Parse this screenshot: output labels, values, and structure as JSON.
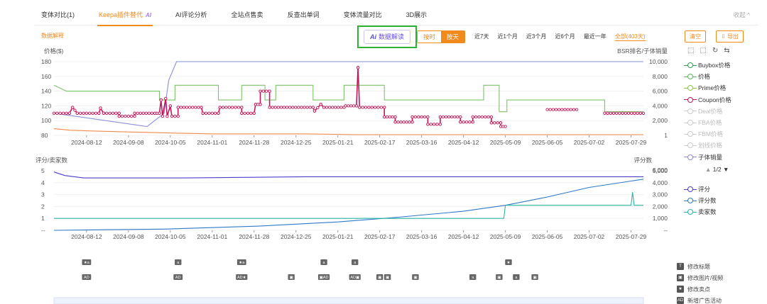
{
  "tabs": [
    {
      "label": "变体对比(1)"
    },
    {
      "label": "Keepa插件替代",
      "badge": "AI"
    },
    {
      "label": "AI评论分析"
    },
    {
      "label": "全站点售卖"
    },
    {
      "label": "反查出单词"
    },
    {
      "label": "变体流量对比"
    },
    {
      "label": "3D展示"
    }
  ],
  "collapse_label": "收起 ^",
  "toolbar": {
    "data_explain": "数据解释",
    "ai_button_icon": "Ai",
    "ai_button_label": "数据解读",
    "mode_hourly": "按时",
    "mode_daily": "按天",
    "ranges": [
      "近7天",
      "近1个月",
      "近3个月",
      "近6个月",
      "最近一年",
      "全部(403天)"
    ],
    "clear_label": "清空",
    "export_label": "导出"
  },
  "chart_icons": [
    "⬚",
    "⬚",
    "↻",
    "⇆"
  ],
  "legend_top": [
    {
      "label": "Buybox价格",
      "color": "#2e9e4f",
      "off": false
    },
    {
      "label": "价格",
      "color": "#5cb85c",
      "off": false
    },
    {
      "label": "Prime价格",
      "color": "#8bc34a",
      "off": false
    },
    {
      "label": "Coupon价格",
      "color": "#c2185b",
      "off": false
    },
    {
      "label": "Deal价格",
      "color": "#cccccc",
      "off": true
    },
    {
      "label": "FBA价格",
      "color": "#cccccc",
      "off": true
    },
    {
      "label": "FBM价格",
      "color": "#cccccc",
      "off": true
    },
    {
      "label": "划线价格",
      "color": "#cccccc",
      "off": true
    },
    {
      "label": "子体销量",
      "color": "#8a8fd8",
      "off": false
    }
  ],
  "legend_pager": "1/2",
  "legend_bottom": [
    {
      "label": "评分",
      "color": "#4b3fc7"
    },
    {
      "label": "评分数",
      "color": "#2f79c9"
    },
    {
      "label": "卖家数",
      "color": "#2bb3a8"
    }
  ],
  "event_legend": [
    {
      "icon": "T",
      "label": "修改标题"
    },
    {
      "icon": "▣",
      "label": "修改图片/视频"
    },
    {
      "icon": "★",
      "label": "修改卖点"
    },
    {
      "icon": "AD",
      "label": "新增广告活动"
    }
  ],
  "chart_data": [
    {
      "type": "line",
      "ylabel": "价格($)",
      "y2label": "BSR排名/子体销量",
      "ylim": [
        80,
        180
      ],
      "yticks": [
        80,
        100,
        120,
        140,
        160,
        180
      ],
      "y2ticks": [
        "1",
        "2,000",
        "4,000",
        "6,000",
        "8,000",
        "10,000"
      ],
      "x_ticks": [
        "2024-08-12",
        "2024-09-08",
        "2024-10-05",
        "2024-11-01",
        "2024-11-28",
        "2024-12-25",
        "2025-01-21",
        "2025-02-17",
        "2025-03-16",
        "2025-04-12",
        "2025-05-09",
        "2025-06-05",
        "2025-07-02",
        "2025-07-29"
      ],
      "series": [
        {
          "name": "价格",
          "color": "#7cc46a",
          "points": [
            [
              "2024-07-22",
              148
            ],
            [
              "2024-07-30",
              140
            ],
            [
              "2024-09-28",
              140
            ],
            [
              "2024-09-28",
              128
            ],
            [
              "2024-10-08",
              128
            ],
            [
              "2024-10-08",
              148
            ],
            [
              "2024-11-05",
              148
            ],
            [
              "2024-11-05",
              128
            ],
            [
              "2024-11-20",
              128
            ],
            [
              "2024-11-20",
              148
            ],
            [
              "2024-12-05",
              148
            ],
            [
              "2024-12-05",
              128
            ],
            [
              "2024-12-12",
              128
            ],
            [
              "2024-12-12",
              148
            ],
            [
              "2025-01-05",
              148
            ],
            [
              "2025-01-05",
              128
            ],
            [
              "2025-01-25",
              128
            ],
            [
              "2025-01-25",
              148
            ],
            [
              "2025-02-20",
              148
            ],
            [
              "2025-02-20",
              128
            ],
            [
              "2025-04-25",
              128
            ],
            [
              "2025-04-25",
              148
            ],
            [
              "2025-05-05",
              148
            ],
            [
              "2025-05-05",
              112
            ],
            [
              "2025-05-10",
              112
            ],
            [
              "2025-05-10",
              128
            ],
            [
              "2025-07-12",
              128
            ],
            [
              "2025-07-12",
              112
            ],
            [
              "2025-08-06",
              112
            ]
          ]
        },
        {
          "name": "子体销量",
          "color": "#8a8fd8",
          "points": [
            [
              "2024-07-22",
              110
            ],
            [
              "2024-09-20",
              92
            ],
            [
              "2024-10-01",
              110
            ],
            [
              "2024-10-04",
              155
            ],
            [
              "2024-10-07",
              170
            ],
            [
              "2024-10-09",
              180
            ],
            [
              "2025-08-06",
              180
            ]
          ]
        },
        {
          "name": "Coupon价格",
          "color": "#c2185b",
          "points": [
            [
              "2024-07-22",
              110
            ],
            [
              "2024-08-01",
              110
            ],
            [
              "2024-08-03",
              118
            ],
            [
              "2024-08-06",
              110
            ],
            [
              "2024-08-20",
              110
            ],
            [
              "2024-08-21",
              117
            ],
            [
              "2024-08-23",
              110
            ],
            [
              "2024-09-02",
              110
            ],
            [
              "2024-09-02",
              106
            ],
            [
              "2024-09-12",
              106
            ],
            [
              "2024-09-12",
              110
            ],
            [
              "2024-09-25",
              110
            ],
            [
              "2024-09-28",
              110
            ],
            [
              "2024-09-29",
              128
            ],
            [
              "2024-09-30",
              106
            ],
            [
              "2024-10-02",
              130
            ],
            [
              "2024-10-03",
              106
            ],
            [
              "2024-10-05",
              120
            ],
            [
              "2024-10-06",
              106
            ],
            [
              "2024-10-10",
              106
            ],
            [
              "2024-10-10",
              118
            ],
            [
              "2024-10-25",
              118
            ],
            [
              "2024-10-26",
              110
            ],
            [
              "2024-11-05",
              110
            ],
            [
              "2024-11-06",
              118
            ],
            [
              "2024-11-20",
              118
            ],
            [
              "2024-11-20",
              110
            ],
            [
              "2024-11-28",
              110
            ],
            [
              "2024-11-29",
              122
            ],
            [
              "2024-12-02",
              122
            ],
            [
              "2024-12-02",
              140
            ],
            [
              "2024-12-08",
              140
            ],
            [
              "2024-12-08",
              118
            ],
            [
              "2025-01-05",
              118
            ],
            [
              "2025-01-06",
              113
            ],
            [
              "2025-01-10",
              122
            ],
            [
              "2025-01-12",
              118
            ],
            [
              "2025-01-25",
              118
            ],
            [
              "2025-01-26",
              120
            ],
            [
              "2025-02-02",
              120
            ],
            [
              "2025-02-03",
              172
            ],
            [
              "2025-02-04",
              118
            ],
            [
              "2025-02-20",
              118
            ],
            [
              "2025-02-20",
              105
            ],
            [
              "2025-02-27",
              105
            ],
            [
              "2025-02-27",
              98
            ],
            [
              "2025-03-10",
              98
            ],
            [
              "2025-03-10",
              105
            ],
            [
              "2025-03-20",
              105
            ],
            [
              "2025-03-20",
              95
            ],
            [
              "2025-03-28",
              95
            ],
            [
              "2025-03-28",
              105
            ],
            [
              "2025-04-10",
              105
            ],
            [
              "2025-04-10",
              98
            ],
            [
              "2025-04-18",
              98
            ],
            [
              "2025-04-18",
              105
            ],
            [
              "2025-04-30",
              105
            ],
            [
              "2025-04-30",
              97
            ],
            [
              "2025-05-06",
              97
            ],
            [
              "2025-05-06",
              92
            ],
            [
              "2025-05-09",
              92
            ]
          ]
        },
        {
          "name": "Coupon价格",
          "color": "#c2185b",
          "points": [
            [
              "2025-06-05",
              115
            ],
            [
              "2025-06-24",
              115
            ]
          ]
        },
        {
          "name": "Coupon价格",
          "color": "#c2185b",
          "points": [
            [
              "2025-07-12",
              110
            ],
            [
              "2025-08-06",
              110
            ]
          ]
        },
        {
          "name": "BSR",
          "color": "#f08a4b",
          "points": [
            [
              "2024-07-22",
              89
            ],
            [
              "2024-08-01",
              87
            ],
            [
              "2024-08-15",
              86
            ],
            [
              "2024-09-01",
              85
            ],
            [
              "2024-09-20",
              84
            ],
            [
              "2024-10-10",
              83
            ],
            [
              "2024-11-01",
              82
            ],
            [
              "2024-12-01",
              82
            ],
            [
              "2025-01-01",
              82
            ],
            [
              "2025-02-01",
              81
            ],
            [
              "2025-03-01",
              81
            ],
            [
              "2025-04-01",
              81
            ],
            [
              "2025-05-01",
              81
            ],
            [
              "2025-06-01",
              81
            ],
            [
              "2025-07-01",
              81
            ],
            [
              "2025-08-06",
              81
            ]
          ]
        }
      ]
    },
    {
      "type": "line",
      "ylabel": "评分/卖家数",
      "y2label": "评分数",
      "ylim": [
        0,
        5
      ],
      "yticks": [
        "--",
        "1",
        "2",
        "3",
        "4",
        "5"
      ],
      "y2ticks": [
        "--",
        "1,000",
        "2,000",
        "3,000",
        "4,000",
        "5,000",
        "6,000"
      ],
      "x_ticks": [
        "2024-08-12",
        "2024-09-08",
        "2024-10-05",
        "2024-11-01",
        "2024-11-28",
        "2024-12-25",
        "2025-01-21",
        "2025-02-17",
        "2025-03-16",
        "2025-04-12",
        "2025-05-09",
        "2025-06-05",
        "2025-07-02",
        "2025-07-29"
      ],
      "series": [
        {
          "name": "评分",
          "color": "#4b3fc7",
          "points": [
            [
              "2024-07-22",
              4.9
            ],
            [
              "2024-07-29",
              4.6
            ],
            [
              "2024-08-10",
              4.4
            ],
            [
              "2024-09-20",
              4.4
            ],
            [
              "2024-10-15",
              4.4
            ],
            [
              "2025-01-01",
              4.5
            ],
            [
              "2025-08-06",
              4.5
            ]
          ]
        },
        {
          "name": "评分数",
          "color": "#2f79c9",
          "points": [
            [
              "2024-07-22",
              0.0
            ],
            [
              "2024-10-01",
              0.1
            ],
            [
              "2024-12-01",
              0.35
            ],
            [
              "2025-01-21",
              0.7
            ],
            [
              "2025-03-01",
              1.1
            ],
            [
              "2025-04-12",
              1.6
            ],
            [
              "2025-05-09",
              2.1
            ],
            [
              "2025-06-05",
              2.8
            ],
            [
              "2025-07-02",
              3.6
            ],
            [
              "2025-08-06",
              4.3
            ]
          ]
        },
        {
          "name": "卖家数",
          "color": "#2bb3a8",
          "points": [
            [
              "2024-07-22",
              1.0
            ],
            [
              "2025-05-08",
              1.0
            ],
            [
              "2025-05-09",
              2.1
            ],
            [
              "2025-07-29",
              2.1
            ],
            [
              "2025-07-30",
              3.2
            ],
            [
              "2025-07-31",
              2.1
            ],
            [
              "2025-08-06",
              2.1
            ]
          ]
        }
      ]
    }
  ],
  "event_markers": [
    {
      "row": 1,
      "date": "2024-08-12",
      "label": "★a"
    },
    {
      "row": 1,
      "date": "2024-10-10",
      "label": "a"
    },
    {
      "row": 1,
      "date": "2024-11-20",
      "label": "★a"
    },
    {
      "row": 1,
      "date": "2025-01-12",
      "label": "a"
    },
    {
      "row": 1,
      "date": "2025-02-01",
      "label": "a"
    },
    {
      "row": 1,
      "date": "2025-05-11",
      "label": "★"
    },
    {
      "row": 2,
      "date": "2024-08-12",
      "label": "AD"
    },
    {
      "row": 2,
      "date": "2024-10-10",
      "label": "AD"
    },
    {
      "row": 2,
      "date": "2024-11-20",
      "label": "AD★"
    },
    {
      "row": 2,
      "date": "2024-12-22",
      "label": "▣"
    },
    {
      "row": 2,
      "date": "2025-01-12",
      "label": "▣AD"
    },
    {
      "row": 2,
      "date": "2025-02-01",
      "label": "AD▣"
    },
    {
      "row": 2,
      "date": "2025-02-17",
      "label": "▣"
    },
    {
      "row": 2,
      "date": "2025-02-22",
      "label": "▣"
    },
    {
      "row": 2,
      "date": "2025-03-12",
      "label": "▣"
    },
    {
      "row": 2,
      "date": "2025-04-18",
      "label": "a"
    },
    {
      "row": 2,
      "date": "2025-05-05",
      "label": "▣"
    },
    {
      "row": 2,
      "date": "2025-05-16",
      "label": "a"
    },
    {
      "row": 2,
      "date": "2025-05-28",
      "label": "▣"
    }
  ]
}
